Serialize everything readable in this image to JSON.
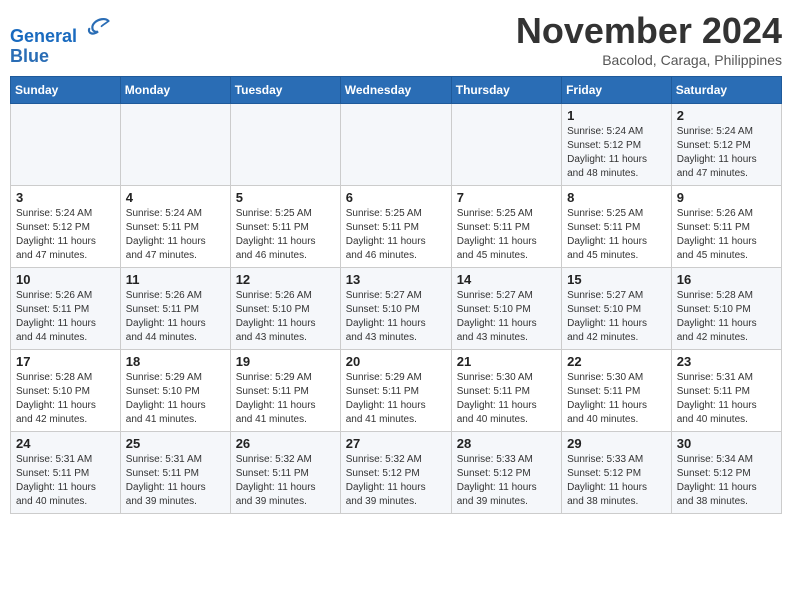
{
  "header": {
    "logo_line1": "General",
    "logo_line2": "Blue",
    "month_title": "November 2024",
    "subtitle": "Bacolod, Caraga, Philippines"
  },
  "weekdays": [
    "Sunday",
    "Monday",
    "Tuesday",
    "Wednesday",
    "Thursday",
    "Friday",
    "Saturday"
  ],
  "weeks": [
    [
      {
        "day": "",
        "info": ""
      },
      {
        "day": "",
        "info": ""
      },
      {
        "day": "",
        "info": ""
      },
      {
        "day": "",
        "info": ""
      },
      {
        "day": "",
        "info": ""
      },
      {
        "day": "1",
        "info": "Sunrise: 5:24 AM\nSunset: 5:12 PM\nDaylight: 11 hours\nand 48 minutes."
      },
      {
        "day": "2",
        "info": "Sunrise: 5:24 AM\nSunset: 5:12 PM\nDaylight: 11 hours\nand 47 minutes."
      }
    ],
    [
      {
        "day": "3",
        "info": "Sunrise: 5:24 AM\nSunset: 5:12 PM\nDaylight: 11 hours\nand 47 minutes."
      },
      {
        "day": "4",
        "info": "Sunrise: 5:24 AM\nSunset: 5:11 PM\nDaylight: 11 hours\nand 47 minutes."
      },
      {
        "day": "5",
        "info": "Sunrise: 5:25 AM\nSunset: 5:11 PM\nDaylight: 11 hours\nand 46 minutes."
      },
      {
        "day": "6",
        "info": "Sunrise: 5:25 AM\nSunset: 5:11 PM\nDaylight: 11 hours\nand 46 minutes."
      },
      {
        "day": "7",
        "info": "Sunrise: 5:25 AM\nSunset: 5:11 PM\nDaylight: 11 hours\nand 45 minutes."
      },
      {
        "day": "8",
        "info": "Sunrise: 5:25 AM\nSunset: 5:11 PM\nDaylight: 11 hours\nand 45 minutes."
      },
      {
        "day": "9",
        "info": "Sunrise: 5:26 AM\nSunset: 5:11 PM\nDaylight: 11 hours\nand 45 minutes."
      }
    ],
    [
      {
        "day": "10",
        "info": "Sunrise: 5:26 AM\nSunset: 5:11 PM\nDaylight: 11 hours\nand 44 minutes."
      },
      {
        "day": "11",
        "info": "Sunrise: 5:26 AM\nSunset: 5:11 PM\nDaylight: 11 hours\nand 44 minutes."
      },
      {
        "day": "12",
        "info": "Sunrise: 5:26 AM\nSunset: 5:10 PM\nDaylight: 11 hours\nand 43 minutes."
      },
      {
        "day": "13",
        "info": "Sunrise: 5:27 AM\nSunset: 5:10 PM\nDaylight: 11 hours\nand 43 minutes."
      },
      {
        "day": "14",
        "info": "Sunrise: 5:27 AM\nSunset: 5:10 PM\nDaylight: 11 hours\nand 43 minutes."
      },
      {
        "day": "15",
        "info": "Sunrise: 5:27 AM\nSunset: 5:10 PM\nDaylight: 11 hours\nand 42 minutes."
      },
      {
        "day": "16",
        "info": "Sunrise: 5:28 AM\nSunset: 5:10 PM\nDaylight: 11 hours\nand 42 minutes."
      }
    ],
    [
      {
        "day": "17",
        "info": "Sunrise: 5:28 AM\nSunset: 5:10 PM\nDaylight: 11 hours\nand 42 minutes."
      },
      {
        "day": "18",
        "info": "Sunrise: 5:29 AM\nSunset: 5:10 PM\nDaylight: 11 hours\nand 41 minutes."
      },
      {
        "day": "19",
        "info": "Sunrise: 5:29 AM\nSunset: 5:11 PM\nDaylight: 11 hours\nand 41 minutes."
      },
      {
        "day": "20",
        "info": "Sunrise: 5:29 AM\nSunset: 5:11 PM\nDaylight: 11 hours\nand 41 minutes."
      },
      {
        "day": "21",
        "info": "Sunrise: 5:30 AM\nSunset: 5:11 PM\nDaylight: 11 hours\nand 40 minutes."
      },
      {
        "day": "22",
        "info": "Sunrise: 5:30 AM\nSunset: 5:11 PM\nDaylight: 11 hours\nand 40 minutes."
      },
      {
        "day": "23",
        "info": "Sunrise: 5:31 AM\nSunset: 5:11 PM\nDaylight: 11 hours\nand 40 minutes."
      }
    ],
    [
      {
        "day": "24",
        "info": "Sunrise: 5:31 AM\nSunset: 5:11 PM\nDaylight: 11 hours\nand 40 minutes."
      },
      {
        "day": "25",
        "info": "Sunrise: 5:31 AM\nSunset: 5:11 PM\nDaylight: 11 hours\nand 39 minutes."
      },
      {
        "day": "26",
        "info": "Sunrise: 5:32 AM\nSunset: 5:11 PM\nDaylight: 11 hours\nand 39 minutes."
      },
      {
        "day": "27",
        "info": "Sunrise: 5:32 AM\nSunset: 5:12 PM\nDaylight: 11 hours\nand 39 minutes."
      },
      {
        "day": "28",
        "info": "Sunrise: 5:33 AM\nSunset: 5:12 PM\nDaylight: 11 hours\nand 39 minutes."
      },
      {
        "day": "29",
        "info": "Sunrise: 5:33 AM\nSunset: 5:12 PM\nDaylight: 11 hours\nand 38 minutes."
      },
      {
        "day": "30",
        "info": "Sunrise: 5:34 AM\nSunset: 5:12 PM\nDaylight: 11 hours\nand 38 minutes."
      }
    ]
  ]
}
